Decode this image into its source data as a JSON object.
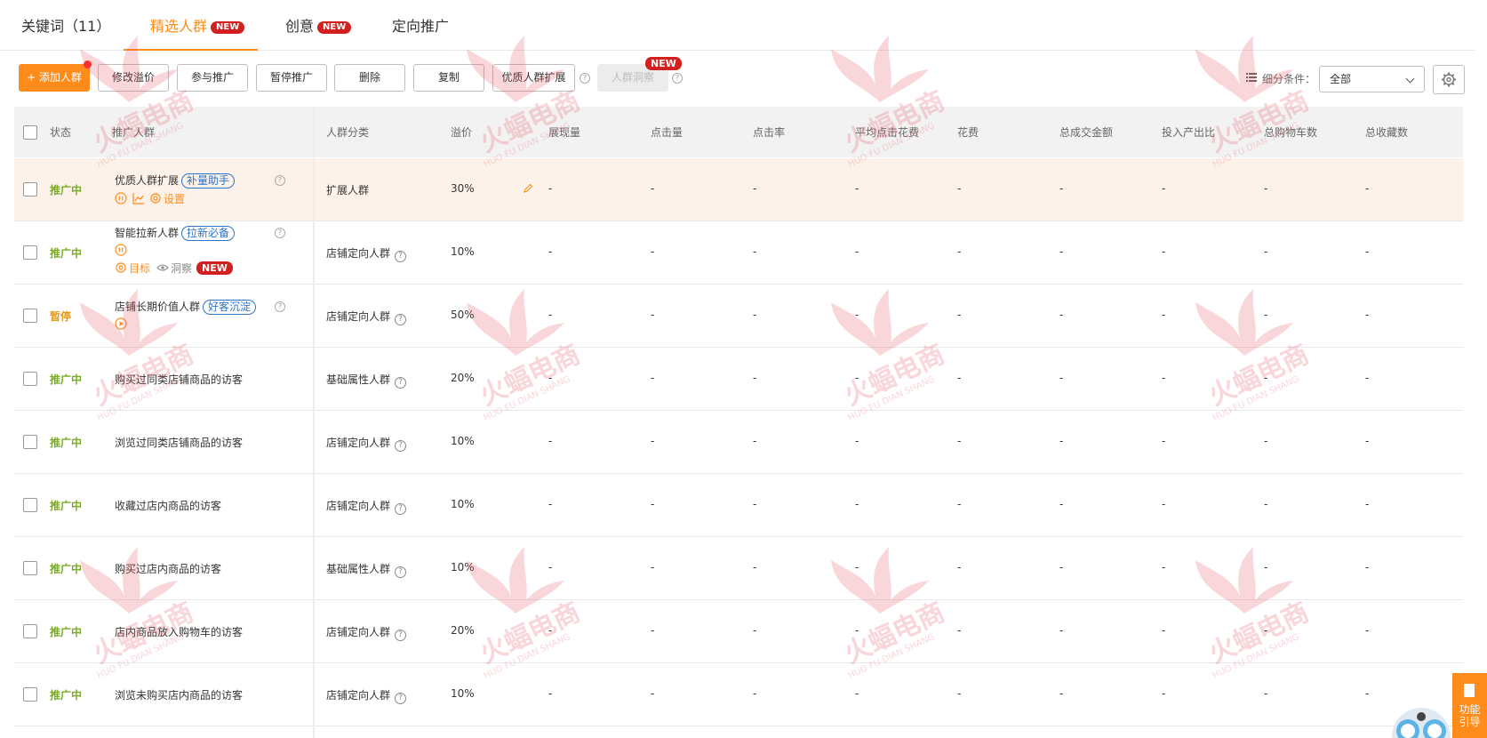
{
  "tabs": [
    {
      "label": "关键词（11）"
    },
    {
      "label": "精选人群",
      "badge": "NEW",
      "active": true
    },
    {
      "label": "创意",
      "badge": "NEW"
    },
    {
      "label": "定向推广"
    }
  ],
  "toolbar": {
    "add": "+ 添加人群",
    "modify_premium": "修改溢价",
    "join": "参与推广",
    "pause": "暂停推广",
    "delete": "删除",
    "copy": "复制",
    "expand": "优质人群扩展",
    "insight": "人群洞察",
    "insight_badge": "NEW",
    "filter_label": "细分条件：",
    "filter_value": "全部"
  },
  "table": {
    "columns": [
      "状态",
      "推广人群",
      "人群分类",
      "溢价",
      "展现量",
      "点击量",
      "点击率",
      "平均点击花费",
      "花费",
      "总成交金额",
      "投入产出比",
      "总购物车数",
      "总收藏数"
    ],
    "rows": [
      {
        "status": "推广中",
        "name": "优质人群扩展",
        "tag": "补量助手",
        "category": "扩展人群",
        "premium": "30%",
        "metrics": [
          "-",
          "-",
          "-",
          "-",
          "-",
          "-",
          "-",
          "-",
          "-"
        ],
        "action": "设置"
      },
      {
        "status": "推广中",
        "name": "智能拉新人群",
        "tag": "拉新必备",
        "category": "店铺定向人群",
        "premium": "10%",
        "metrics": [
          "-",
          "-",
          "-",
          "-",
          "-",
          "-",
          "-",
          "-",
          "-"
        ],
        "action": "目标",
        "action2": "洞察",
        "badge": "NEW"
      },
      {
        "status": "暂停",
        "name": "店铺长期价值人群",
        "tag": "好客沉淀",
        "category": "店铺定向人群",
        "premium": "50%",
        "metrics": [
          "-",
          "-",
          "-",
          "-",
          "-",
          "-",
          "-",
          "-",
          "-"
        ]
      },
      {
        "status": "推广中",
        "name": "购买过同类店铺商品的访客",
        "category": "基础属性人群",
        "premium": "20%",
        "metrics": [
          "-",
          "-",
          "-",
          "-",
          "-",
          "-",
          "-",
          "-",
          "-"
        ]
      },
      {
        "status": "推广中",
        "name": "浏览过同类店铺商品的访客",
        "category": "店铺定向人群",
        "premium": "10%",
        "metrics": [
          "-",
          "-",
          "-",
          "-",
          "-",
          "-",
          "-",
          "-",
          "-"
        ]
      },
      {
        "status": "推广中",
        "name": "收藏过店内商品的访客",
        "category": "店铺定向人群",
        "premium": "10%",
        "metrics": [
          "-",
          "-",
          "-",
          "-",
          "-",
          "-",
          "-",
          "-",
          "-"
        ]
      },
      {
        "status": "推广中",
        "name": "购买过店内商品的访客",
        "category": "基础属性人群",
        "premium": "10%",
        "metrics": [
          "-",
          "-",
          "-",
          "-",
          "-",
          "-",
          "-",
          "-",
          "-"
        ]
      },
      {
        "status": "推广中",
        "name": "店内商品放入购物车的访客",
        "category": "店铺定向人群",
        "premium": "20%",
        "metrics": [
          "-",
          "-",
          "-",
          "-",
          "-",
          "-",
          "-",
          "-",
          "-"
        ]
      },
      {
        "status": "推广中",
        "name": "浏览未购买店内商品的访客",
        "category": "店铺定向人群",
        "premium": "10%",
        "metrics": [
          "-",
          "-",
          "-",
          "-",
          "-",
          "-",
          "-",
          "-",
          "-"
        ]
      }
    ]
  },
  "watermark": {
    "text": "火蝠电商",
    "sub": "HUO FU DIAN SHANG"
  },
  "guide": {
    "line1": "功能",
    "line2": "引导"
  },
  "colors": {
    "accent": "#ff8c1a",
    "running": "#7bab2a",
    "paused": "#e89a1e",
    "badge": "#d21f1f",
    "tag": "#2f74c8"
  }
}
